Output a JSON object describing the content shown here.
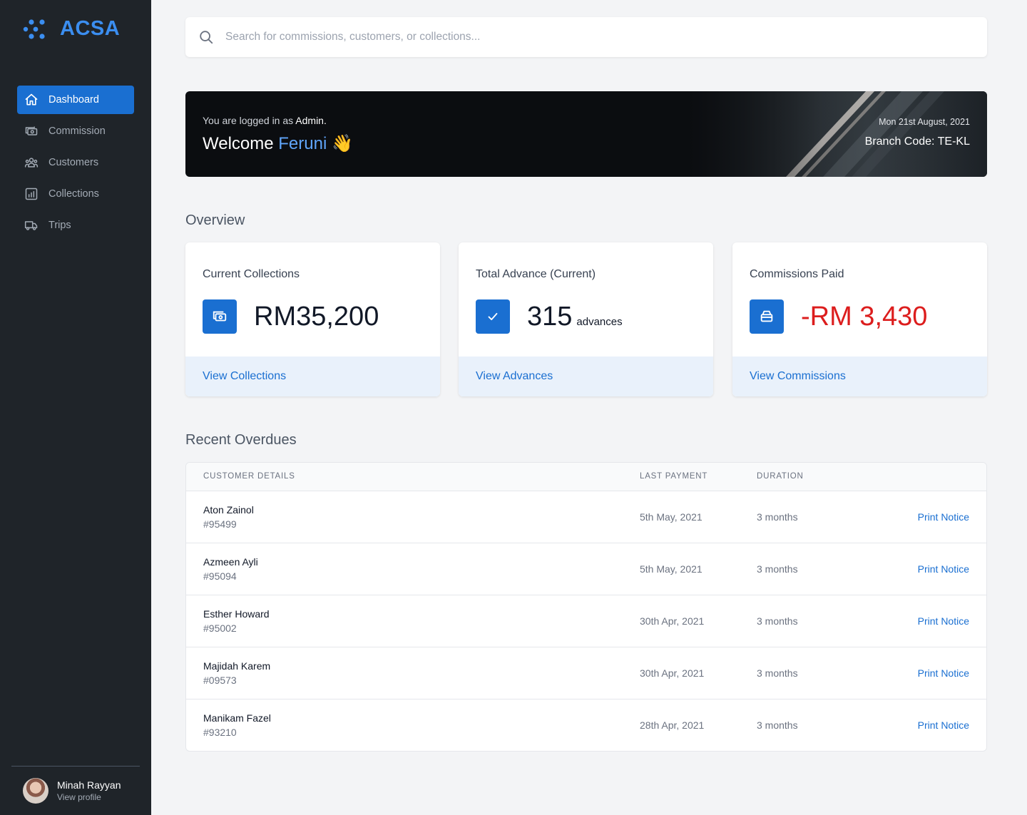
{
  "app": {
    "name": "ACSA"
  },
  "sidebar": {
    "items": [
      {
        "label": "Dashboard",
        "icon": "home-icon",
        "active": true
      },
      {
        "label": "Commission",
        "icon": "cash-icon"
      },
      {
        "label": "Customers",
        "icon": "users-icon"
      },
      {
        "label": "Collections",
        "icon": "chart-bar-icon"
      },
      {
        "label": "Trips",
        "icon": "truck-icon"
      }
    ],
    "profile": {
      "name": "Minah Rayyan",
      "link": "View profile"
    }
  },
  "search": {
    "placeholder": "Search for commissions, customers, or collections..."
  },
  "banner": {
    "logged_in_prefix": "You are logged in as",
    "role": "Admin.",
    "welcome": "Welcome",
    "user": "Feruni",
    "emoji": "👋",
    "date": "Mon 21st August, 2021",
    "branch": "Branch Code: TE-KL"
  },
  "overview": {
    "title": "Overview",
    "cards": [
      {
        "label": "Current Collections",
        "value": "RM35,200",
        "unit": "",
        "link": "View Collections",
        "icon": "cash-icon"
      },
      {
        "label": "Total Advance (Current)",
        "value": "315",
        "unit": "advances",
        "link": "View Advances",
        "icon": "check-icon"
      },
      {
        "label": "Commissions Paid",
        "value": "-RM 3,430",
        "unit": "",
        "link": "View Commissions",
        "icon": "archive-icon"
      }
    ]
  },
  "overdues": {
    "title": "Recent Overdues",
    "columns": {
      "customer": "CUSTOMER DETAILS",
      "last_payment": "LAST PAYMENT",
      "duration": "DURATION"
    },
    "rows": [
      {
        "name": "Aton Zainol",
        "id": "#95499",
        "last_payment": "5th May, 2021",
        "duration": "3 months",
        "action": "Print Notice"
      },
      {
        "name": "Azmeen Ayli",
        "id": "#95094",
        "last_payment": "5th May, 2021",
        "duration": "3 months",
        "action": "Print Notice"
      },
      {
        "name": "Esther Howard",
        "id": "#95002",
        "last_payment": "30th Apr, 2021",
        "duration": "3 months",
        "action": "Print Notice"
      },
      {
        "name": "Majidah Karem",
        "id": "#09573",
        "last_payment": "30th Apr, 2021",
        "duration": "3 months",
        "action": "Print Notice"
      },
      {
        "name": "Manikam Fazel",
        "id": "#93210",
        "last_payment": "28th Apr, 2021",
        "duration": "3 months",
        "action": "Print Notice"
      }
    ]
  },
  "colors": {
    "accent": "#1a6fd1",
    "sidebar_bg": "#1f2429",
    "negative": "#dc1d1d",
    "logo": "#3b8ef0"
  }
}
